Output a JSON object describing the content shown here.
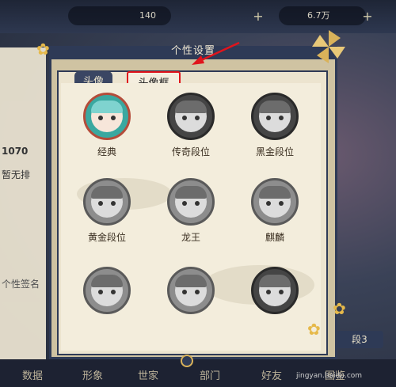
{
  "topbar": {
    "res1": "140",
    "res2": "6.7万"
  },
  "panel": {
    "title": "个性设置"
  },
  "tabs": {
    "avatar": "头像",
    "frame": "头像框"
  },
  "frames": [
    {
      "label": "经典"
    },
    {
      "label": "传奇段位"
    },
    {
      "label": "黑金段位"
    },
    {
      "label": "黄金段位"
    },
    {
      "label": "龙王"
    },
    {
      "label": "麒麟"
    },
    {
      "label": ""
    },
    {
      "label": ""
    },
    {
      "label": ""
    }
  ],
  "behind": {
    "num": "1070",
    "text1": "暂无排",
    "text2": "个性签名"
  },
  "bottom": {
    "b1": "数据",
    "b2": "形象",
    "b3": "世家",
    "b4": "部门",
    "b5": "好友",
    "b6": "图鉴"
  },
  "right_badge": "段3",
  "watermark": "jingyan.baidu.com",
  "colors": {
    "accent_red": "#e0141c",
    "panel_border": "#2e3a56"
  }
}
